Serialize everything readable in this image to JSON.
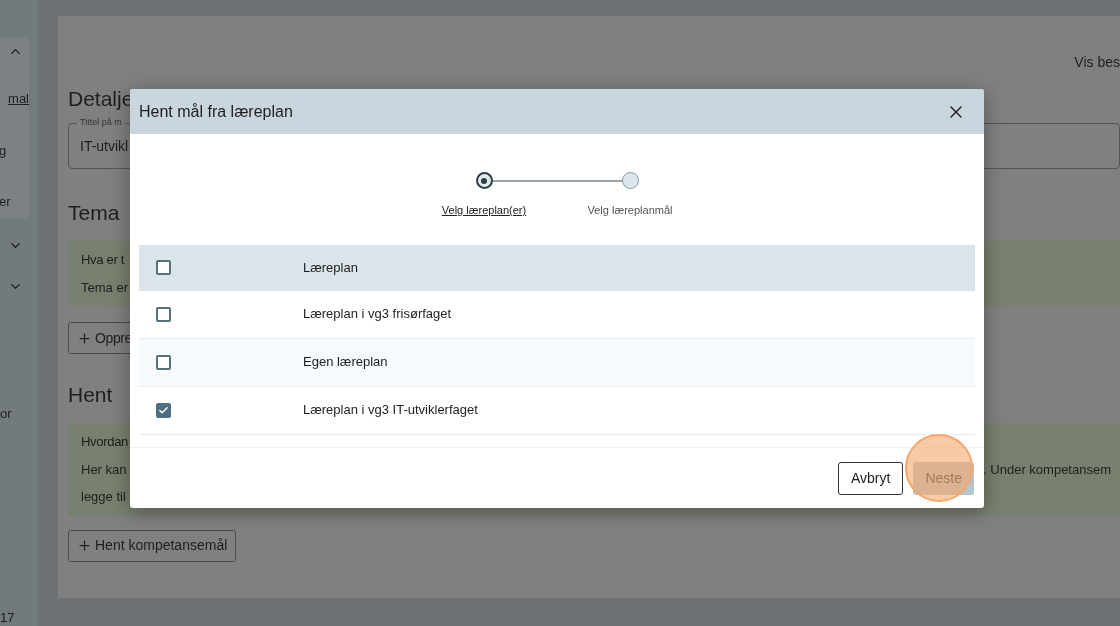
{
  "sidebar": {
    "sections": [
      {
        "expanded": true,
        "items": [
          {
            "label": "mal",
            "kind": "link"
          },
          {
            "label": "g",
            "kind": "text"
          },
          {
            "label": "er",
            "kind": "text"
          }
        ]
      },
      {
        "expanded": false
      },
      {
        "expanded": false
      }
    ],
    "fragment": "or",
    "footer": "17"
  },
  "page": {
    "link": "Vis bes",
    "heading": "Detalje",
    "title_field": {
      "label": "Tittel på m",
      "value": "IT-utvikl"
    },
    "sections": [
      {
        "heading": "Tema",
        "info_title": "Hva er t",
        "info_lines": [
          "Tema er"
        ],
        "button": "Oppre"
      },
      {
        "heading": "Hent",
        "info_title": "Hvordan",
        "info_lines": [
          "Her kan",
          "legge til"
        ],
        "info_tail": ". Under kompetansem",
        "button": "Hent kompetansemål"
      }
    ]
  },
  "dialog": {
    "title": "Hent mål fra læreplan",
    "steps": [
      {
        "label": "Velg læreplan(er)",
        "selected": true
      },
      {
        "label": "Velg læreplanmål",
        "selected": false
      }
    ],
    "header_row": {
      "label": "Læreplan",
      "checked": false
    },
    "rows": [
      {
        "label": "Læreplan i vg3 frisørfaget",
        "checked": false
      },
      {
        "label": "Egen læreplan",
        "checked": false
      },
      {
        "label": "Læreplan i vg3 IT-utviklerfaget",
        "checked": true
      }
    ],
    "buttons": [
      {
        "kind": "secondary",
        "label": "Avbryt",
        "highlighted": false
      },
      {
        "kind": "primary",
        "label": "Neste",
        "highlighted": true
      }
    ]
  }
}
